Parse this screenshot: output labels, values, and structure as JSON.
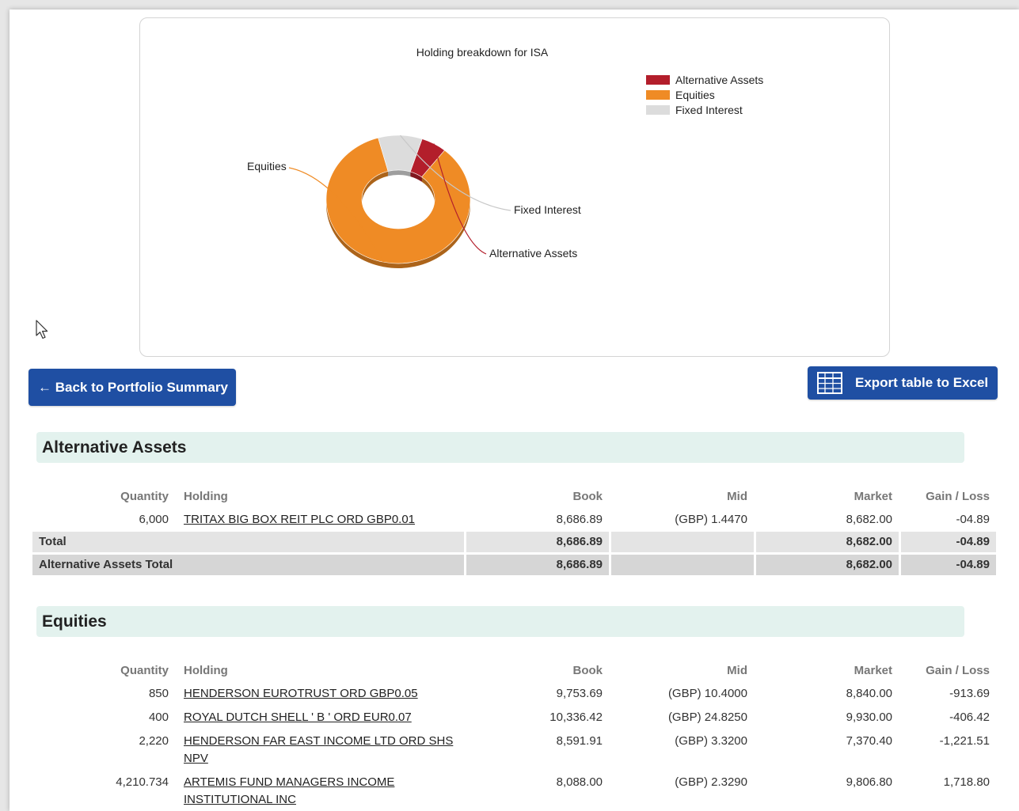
{
  "chart_data": {
    "type": "pie",
    "variant": "donut-3d",
    "title": "Holding breakdown for ISA",
    "categories": [
      "Alternative Assets",
      "Equities",
      "Fixed Interest"
    ],
    "values": [
      8682.0,
      128000.0,
      15000.0
    ],
    "colors": [
      "#b31e2b",
      "#ef8b25",
      "#dcdcdc"
    ],
    "legend": [
      "Alternative Assets",
      "Equities",
      "Fixed Interest"
    ],
    "legend_position": "top-right",
    "labels": [
      "Alternative Assets",
      "Equities",
      "Fixed Interest"
    ]
  },
  "buttons": {
    "back_label": "← Back to Portfolio Summary",
    "export_label": "Export table to Excel"
  },
  "columns": {
    "quantity": "Quantity",
    "holding": "Holding",
    "book": "Book",
    "mid": "Mid",
    "market": "Market",
    "gain_loss": "Gain / Loss"
  },
  "sections": [
    {
      "title": "Alternative Assets",
      "rows": [
        {
          "quantity": "6,000",
          "holding": "TRITAX BIG BOX REIT PLC ORD GBP0.01",
          "book": "8,686.89",
          "mid": "(GBP) 1.4470",
          "market": "8,682.00",
          "gain_loss": "-04.89"
        }
      ],
      "total": {
        "label": "Total",
        "book": "8,686.89",
        "market": "8,682.00",
        "gain_loss": "-04.89"
      },
      "grand_total": {
        "label": "Alternative Assets Total",
        "book": "8,686.89",
        "market": "8,682.00",
        "gain_loss": "-04.89"
      }
    },
    {
      "title": "Equities",
      "rows": [
        {
          "quantity": "850",
          "holding": "HENDERSON EUROTRUST ORD GBP0.05",
          "book": "9,753.69",
          "mid": "(GBP) 10.4000",
          "market": "8,840.00",
          "gain_loss": "-913.69"
        },
        {
          "quantity": "400",
          "holding": "ROYAL DUTCH SHELL ' B ' ORD EUR0.07",
          "book": "10,336.42",
          "mid": "(GBP) 24.8250",
          "market": "9,930.00",
          "gain_loss": "-406.42"
        },
        {
          "quantity": "2,220",
          "holding": "HENDERSON FAR EAST INCOME LTD ORD SHS NPV",
          "book": "8,591.91",
          "mid": "(GBP) 3.3200",
          "market": "7,370.40",
          "gain_loss": "-1,221.51"
        },
        {
          "quantity": "4,210.734",
          "holding": "ARTEMIS FUND MANAGERS INCOME INSTITUTIONAL INC",
          "book": "8,088.00",
          "mid": "(GBP) 2.3290",
          "market": "9,806.80",
          "gain_loss": "1,718.80"
        }
      ]
    }
  ]
}
